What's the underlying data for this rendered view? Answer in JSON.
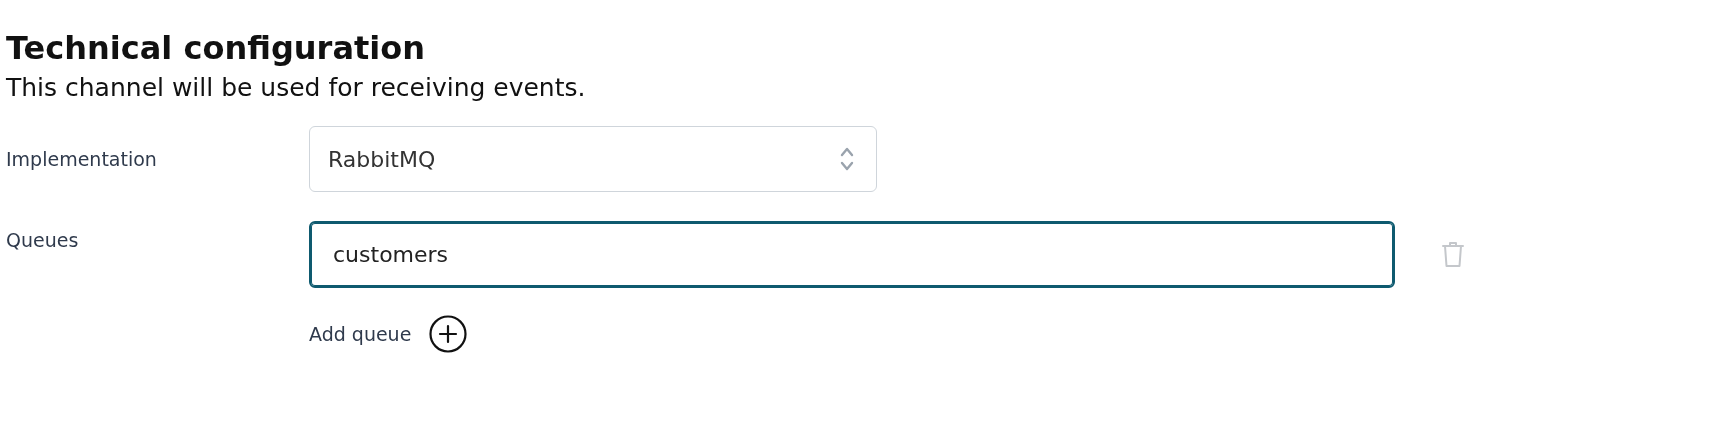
{
  "section": {
    "title": "Technical configuration",
    "subtitle": "This channel will be used for receiving events."
  },
  "implementation": {
    "label": "Implementation",
    "value": "RabbitMQ"
  },
  "queues": {
    "label": "Queues",
    "items": [
      {
        "value": "customers",
        "focused": true
      }
    ],
    "add_label": "Add queue"
  }
}
